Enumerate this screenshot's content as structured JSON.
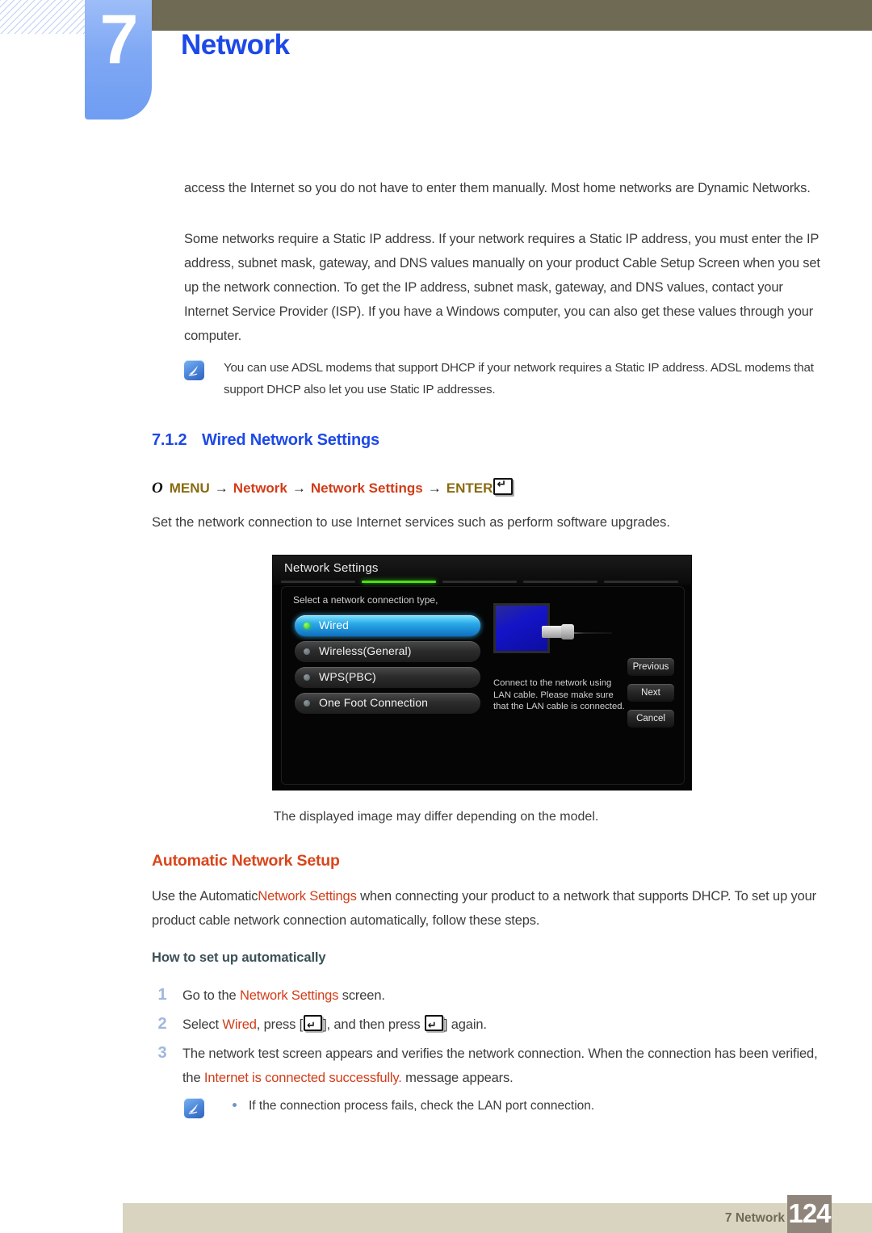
{
  "header": {
    "chapter_number": "7",
    "chapter_title": "Network"
  },
  "body": {
    "paragraph_dynamic": "access the Internet so you do not have to enter them manually. Most home networks are Dynamic Networks.",
    "paragraph_static": "Some networks require a Static IP address. If your network requires a Static IP address, you must enter the IP address, subnet mask, gateway, and DNS values manually on your product Cable Setup Screen when you set up the network connection. To get the IP address, subnet mask, gateway, and DNS values, contact your Internet Service Provider (ISP). If you have a Windows computer, you can also get these values through your computer.",
    "note_adsl": "You can use ADSL modems that support DHCP if your network requires a Static IP address. ADSL modems that support DHCP also let you use Static IP addresses."
  },
  "section": {
    "number": "7.1.2",
    "title": "Wired Network Settings",
    "menu_path": {
      "bullet": "O",
      "menu": "MENU",
      "arrow": "→",
      "network": "Network",
      "network_settings": "Network Settings",
      "enter": "ENTER"
    },
    "lead": "Set the network connection to use Internet services such as perform software upgrades."
  },
  "screenshot": {
    "title": "Network Settings",
    "subtitle": "Select a network connection type,",
    "options": [
      {
        "label": "Wired",
        "selected": true
      },
      {
        "label": "Wireless(General)",
        "selected": false
      },
      {
        "label": "WPS(PBC)",
        "selected": false
      },
      {
        "label": "One Foot Connection",
        "selected": false
      }
    ],
    "description": "Connect to the network using LAN cable. Please make sure that the LAN cable is connected.",
    "buttons": [
      "Previous",
      "Next",
      "Cancel"
    ],
    "progress_segments": 5,
    "progress_active_index": 1,
    "accent_color": "#49e016"
  },
  "caption": "The displayed image may differ depending on the model.",
  "automatic": {
    "heading": "Automatic Network Setup",
    "para_prefix": "Use the Automatic",
    "para_highlight": "Network Settings",
    "para_suffix": " when connecting your product to a network that supports DHCP. To set up your product cable network connection automatically, follow these steps.",
    "subheading": "How to set up automatically"
  },
  "steps": [
    {
      "number": "1",
      "prefix": "Go to the ",
      "highlight": "Network Settings",
      "suffix": " screen."
    },
    {
      "number": "2",
      "prefix": "Select ",
      "highlight": "Wired",
      "mid": ", press [",
      "mid2": "], and then press ",
      "suffix": "] again."
    },
    {
      "number": "3",
      "prefix": "The network test screen appears and verifies the network connection. When the connection has been verified, the ",
      "highlight": "Internet is connected successfully.",
      "suffix": " message appears."
    }
  ],
  "bottom_note": "If the connection process fails, check the LAN port connection.",
  "footer": {
    "label": "7 Network",
    "page": "124"
  },
  "colors": {
    "chapter_blue": "#1d49e8",
    "heading_orange": "#d9451a",
    "menu_gold": "#8a6a12",
    "menu_red": "#d23c18",
    "olive_bar": "#6e6a54",
    "footer_bar": "#d9d4bf",
    "page_box": "#90857a"
  }
}
